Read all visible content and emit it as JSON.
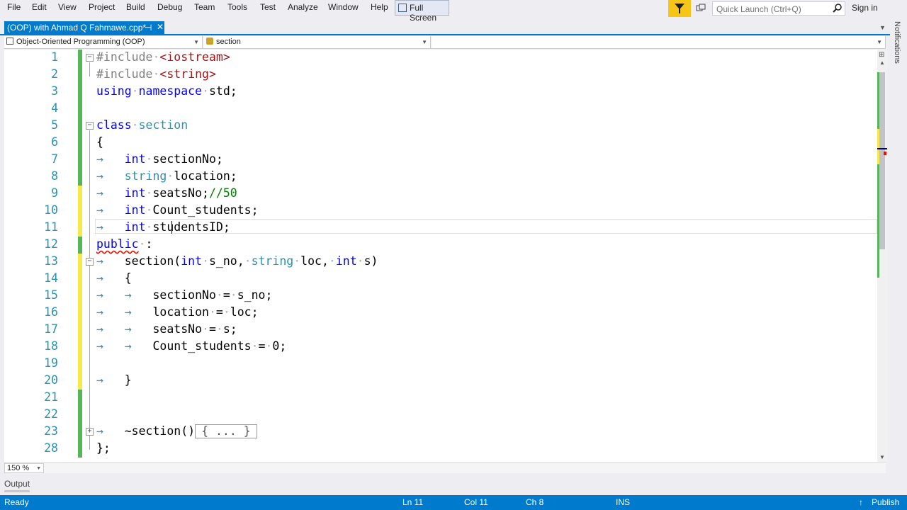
{
  "menu": [
    "File",
    "Edit",
    "View",
    "Project",
    "Build",
    "Debug",
    "Team",
    "Tools",
    "Test",
    "Analyze",
    "Window",
    "Help"
  ],
  "fullscreen_label": "Full Screen",
  "quick_launch_placeholder": "Quick Launch (Ctrl+Q)",
  "signin_label": "Sign in",
  "notifications_label": "Notifications",
  "tab": {
    "title": "(OOP) with Ahmad Q Fahmawe.cpp*",
    "pin": "⊣",
    "close": "✕"
  },
  "nav": {
    "project": "Object-Oriented Programming (OOP)",
    "scope": "section",
    "member": ""
  },
  "code_lines": [
    {
      "num": "1"
    },
    {
      "num": "2"
    },
    {
      "num": "3"
    },
    {
      "num": "4"
    },
    {
      "num": "5"
    },
    {
      "num": "6"
    },
    {
      "num": "7"
    },
    {
      "num": "8"
    },
    {
      "num": "9"
    },
    {
      "num": "10"
    },
    {
      "num": "11"
    },
    {
      "num": "12"
    },
    {
      "num": "13"
    },
    {
      "num": "14"
    },
    {
      "num": "15"
    },
    {
      "num": "16"
    },
    {
      "num": "17"
    },
    {
      "num": "18"
    },
    {
      "num": "19"
    },
    {
      "num": "20"
    },
    {
      "num": "21"
    },
    {
      "num": "22"
    },
    {
      "num": "23"
    },
    {
      "num": "28"
    }
  ],
  "code": {
    "include1_dir": "#include",
    "include1_hdr": "<iostream>",
    "include2_dir": "#include",
    "include2_hdr": "<string>",
    "using": "using",
    "namespace": "namespace",
    "std": "std;",
    "class": "class",
    "class_name": "section",
    "open_brace": "{",
    "int": "int",
    "string": "string",
    "sectionNo_decl": "sectionNo;",
    "location_decl": "location;",
    "seatsNo_decl": "seatsNo;",
    "seatsNo_comment": "//50",
    "count_decl": "Count_students;",
    "studentsID_decl": "studentsID;",
    "public": "public",
    "public_colon": ":",
    "ctor_name": "section(",
    "param1": "s_no,",
    "param2": "loc,",
    "param3": "s)",
    "assign1": "sectionNo",
    "assign1_rhs": "s_no;",
    "assign2": "location",
    "assign2_rhs": "loc;",
    "assign3": "seatsNo",
    "assign3_rhs": "s;",
    "assign4": "Count_students",
    "assign4_rhs": "0;",
    "close_brace": "}",
    "dtor": "~section()",
    "collapsed": "{ ... }",
    "class_end": "};"
  },
  "zoom_level": "150 %",
  "output_label": "Output",
  "status": {
    "ready": "Ready",
    "ln": "Ln 11",
    "col": "Col 11",
    "ch": "Ch 8",
    "ins": "INS",
    "publish": "Publish"
  },
  "colors": {
    "accent": "#007acc",
    "keyword": "#0000ff",
    "type": "#2b91af",
    "string": "#a31515",
    "comment": "#008000",
    "change_saved": "#57b45a",
    "change_unsaved": "#f7e84b"
  }
}
